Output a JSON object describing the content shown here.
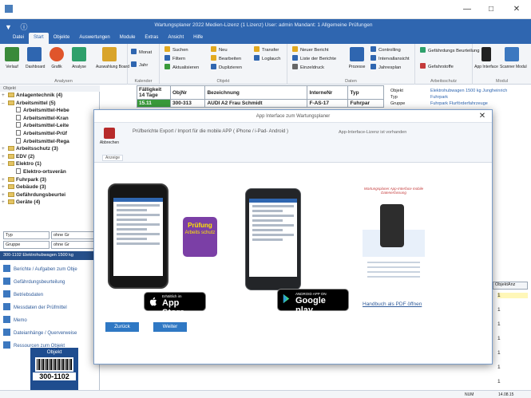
{
  "window": {
    "title": "Wartungsplaner 2022 Medien-Lizenz (1 Lizenz)   User: admin   Mandant: 1 Allgemeine Prüfungen",
    "min": "—",
    "max": "□",
    "close": "✕"
  },
  "qat": {
    "icons": [
      "▼",
      "ⓘ"
    ]
  },
  "tabs": [
    "Datei",
    "Start",
    "Objekte",
    "Auswertungen",
    "Module",
    "Extras",
    "Ansicht",
    "Hilfe"
  ],
  "ribbon": {
    "analysen": {
      "label": "Analysen",
      "buttons": [
        "Verlauf",
        "Dashboard",
        "Grafik",
        "Analyse",
        "Auswahlung Board"
      ]
    },
    "kalender": {
      "label": "Kalender",
      "buttons": [
        "Monat",
        "Jahr"
      ]
    },
    "objekt": {
      "label": "Objekt",
      "buttons": [
        "Suchen",
        "Filtern",
        "Aktualisieren",
        "Neu",
        "Bearbeiten",
        "Duplizieren",
        "Transfer",
        "Loglauch"
      ]
    },
    "daten": {
      "label": "Daten",
      "buttons": [
        "Neuer Bericht",
        "Liste der Berichte",
        "Einzeldruck",
        "Prozesse",
        "Controlling",
        "Intervallansicht",
        "Jahresplan"
      ]
    },
    "arbeitsschutz": {
      "label": "Arbeitsschutz",
      "buttons": [
        "Gefährdungs Beurteilung",
        "Gefahrstoffe"
      ]
    },
    "modul": {
      "label": "Modul",
      "buttons": [
        "App Interface",
        "Scanner Modul"
      ]
    }
  },
  "tree": {
    "header": "Objekt",
    "items": [
      {
        "glyph": "+",
        "label": "Anlagentechnik  (4)",
        "kind": "folder",
        "indent": 0
      },
      {
        "glyph": "–",
        "label": "Arbeitsmittel  (5)",
        "kind": "folder",
        "indent": 0
      },
      {
        "glyph": "",
        "label": "Arbeitsmittel-Hebe",
        "kind": "doc",
        "indent": 1
      },
      {
        "glyph": "",
        "label": "Arbeitsmittel-Kran",
        "kind": "doc",
        "indent": 1
      },
      {
        "glyph": "",
        "label": "Arbeitsmittel-Leite",
        "kind": "doc",
        "indent": 1
      },
      {
        "glyph": "",
        "label": "Arbeitsmittel-Prüf",
        "kind": "doc",
        "indent": 1
      },
      {
        "glyph": "",
        "label": "Arbeitsmittel-Rega",
        "kind": "doc",
        "indent": 1
      },
      {
        "glyph": "+",
        "label": "Arbeitsschutz  (3)",
        "kind": "folder",
        "indent": 0
      },
      {
        "glyph": "+",
        "label": "EDV  (2)",
        "kind": "folder",
        "indent": 0
      },
      {
        "glyph": "–",
        "label": "Elektro  (1)",
        "kind": "folder",
        "indent": 0
      },
      {
        "glyph": "",
        "label": "Elektro-ortsverän",
        "kind": "doc",
        "indent": 1
      },
      {
        "glyph": "+",
        "label": "Fuhrpark  (3)",
        "kind": "folder",
        "indent": 0
      },
      {
        "glyph": "+",
        "label": "Gebäude  (3)",
        "kind": "folder",
        "indent": 0
      },
      {
        "glyph": "+",
        "label": "Gefährdungsbeurtei",
        "kind": "folder",
        "indent": 0
      },
      {
        "glyph": "+",
        "label": "Geräte  (4)",
        "kind": "folder",
        "indent": 0
      }
    ]
  },
  "filters": [
    {
      "left": "Typ",
      "right": "ohne Gr"
    },
    {
      "left": "Gruppe",
      "right": "ohne Gr"
    }
  ],
  "objbar": "300-1102 Elektrohubwagen 1500 kg",
  "nav": [
    "Berichte / Aufgaben zum Obje",
    "Gefährdungsbeurteilung",
    "Betriebsdaten",
    "Messdaten der Prüfmittel",
    "Memo",
    "Dateianhänge / Querverweise",
    "Ressourcen zum Objekt"
  ],
  "objcard": {
    "title": "Objekt",
    "number": "300-1102"
  },
  "grid": {
    "headers": [
      "Fälligkeit 14 Tage",
      "ObjNr",
      "Bezeichnung",
      "InterneNr",
      "Typ"
    ],
    "row": [
      "15.11",
      "300-313",
      "AUDI A2 Frau Schmidt",
      "F-AS-17",
      "Fuhrpar"
    ]
  },
  "rightpane": {
    "labels": [
      "Objekt",
      "Typ",
      "Gruppe"
    ],
    "values": [
      "Elektrohubwagen 1500 kg Jungheinrich",
      "Fuhrpark",
      "Fuhrpark Flurförderfahrzeuge"
    ]
  },
  "objektanz": {
    "header": "ObjektAnz",
    "values": [
      "1",
      "1",
      "1",
      "1",
      "1",
      "1",
      "1"
    ]
  },
  "status": {
    "num": "NUM",
    "date": "14.08.15"
  },
  "dialog": {
    "title": "App Interface zum Wartungsplaner",
    "close": "✕",
    "exit_label": "Abbrechen",
    "tab": "Anzeige",
    "description": "Prüfberichte Export / Import für die mobile APP ( iPhone / i-Pad- Android )",
    "status": "App-Interface-Lizenz ist vorhanden",
    "ios_badge": {
      "small": "Erhältlich im",
      "big": "App Store"
    },
    "gp_badge": {
      "small": "ANDROID APP ON",
      "big": "Google play"
    },
    "logo": {
      "title": "Prüfung",
      "sub": "Arbeits schutz"
    },
    "flyer_title": "Wartungsplaner App-Interface mobile Datenerfassung",
    "pdf_link": "Handbuch als PDF öffnen",
    "back": "Zurück",
    "next": "Weiter"
  }
}
